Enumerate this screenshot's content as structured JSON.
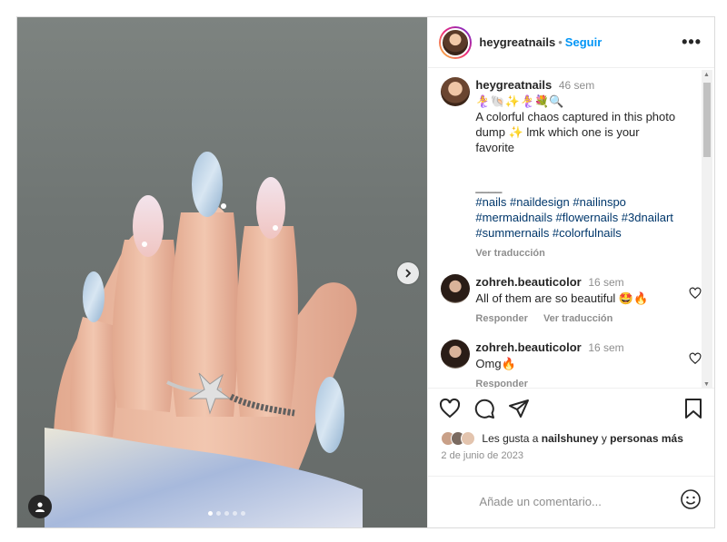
{
  "post": {
    "username": "heygreatnails",
    "separator": "•",
    "follow_label": "Seguir",
    "more_label": "•••"
  },
  "caption": {
    "username": "heygreatnails",
    "time": "46 sem",
    "emoji_line": "🧜‍♀️🐚✨🧜‍♀️💐🔍",
    "text": "A colorful chaos captured in this photo dump ✨ lmk which one is your favorite",
    "divider": "____",
    "hashtags": "#nails #naildesign #nailinspo #mermaidnails #flowernails #3dnailart #summernails #colorfulnails",
    "translate_label": "Ver traducción"
  },
  "comments": [
    {
      "username": "zohreh.beauticolor",
      "time": "16 sem",
      "text": "All of them are so beautiful 🤩🔥",
      "reply_label": "Responder",
      "translate_label": "Ver traducción"
    },
    {
      "username": "zohreh.beauticolor",
      "time": "16 sem",
      "text": "Omg🔥",
      "reply_label": "Responder"
    }
  ],
  "likes": {
    "prefix": "Les gusta a",
    "user": "nailshuney",
    "conj": "y",
    "rest": "personas más"
  },
  "date": "2 de junio de 2023",
  "add_comment": {
    "placeholder": "Añade un comentario..."
  },
  "carousel": {
    "total": 5,
    "active": 1
  },
  "icons": {
    "more": "more-horizontal-icon",
    "heart": "heart-icon",
    "comment": "comment-icon",
    "share": "share-icon",
    "save": "bookmark-icon",
    "emoji": "emoji-icon",
    "next": "chevron-right-icon",
    "tag": "user-tag-icon"
  },
  "colors": {
    "accent": "#0095f6",
    "hashtag": "#00376b",
    "muted": "#8e8e8e"
  }
}
